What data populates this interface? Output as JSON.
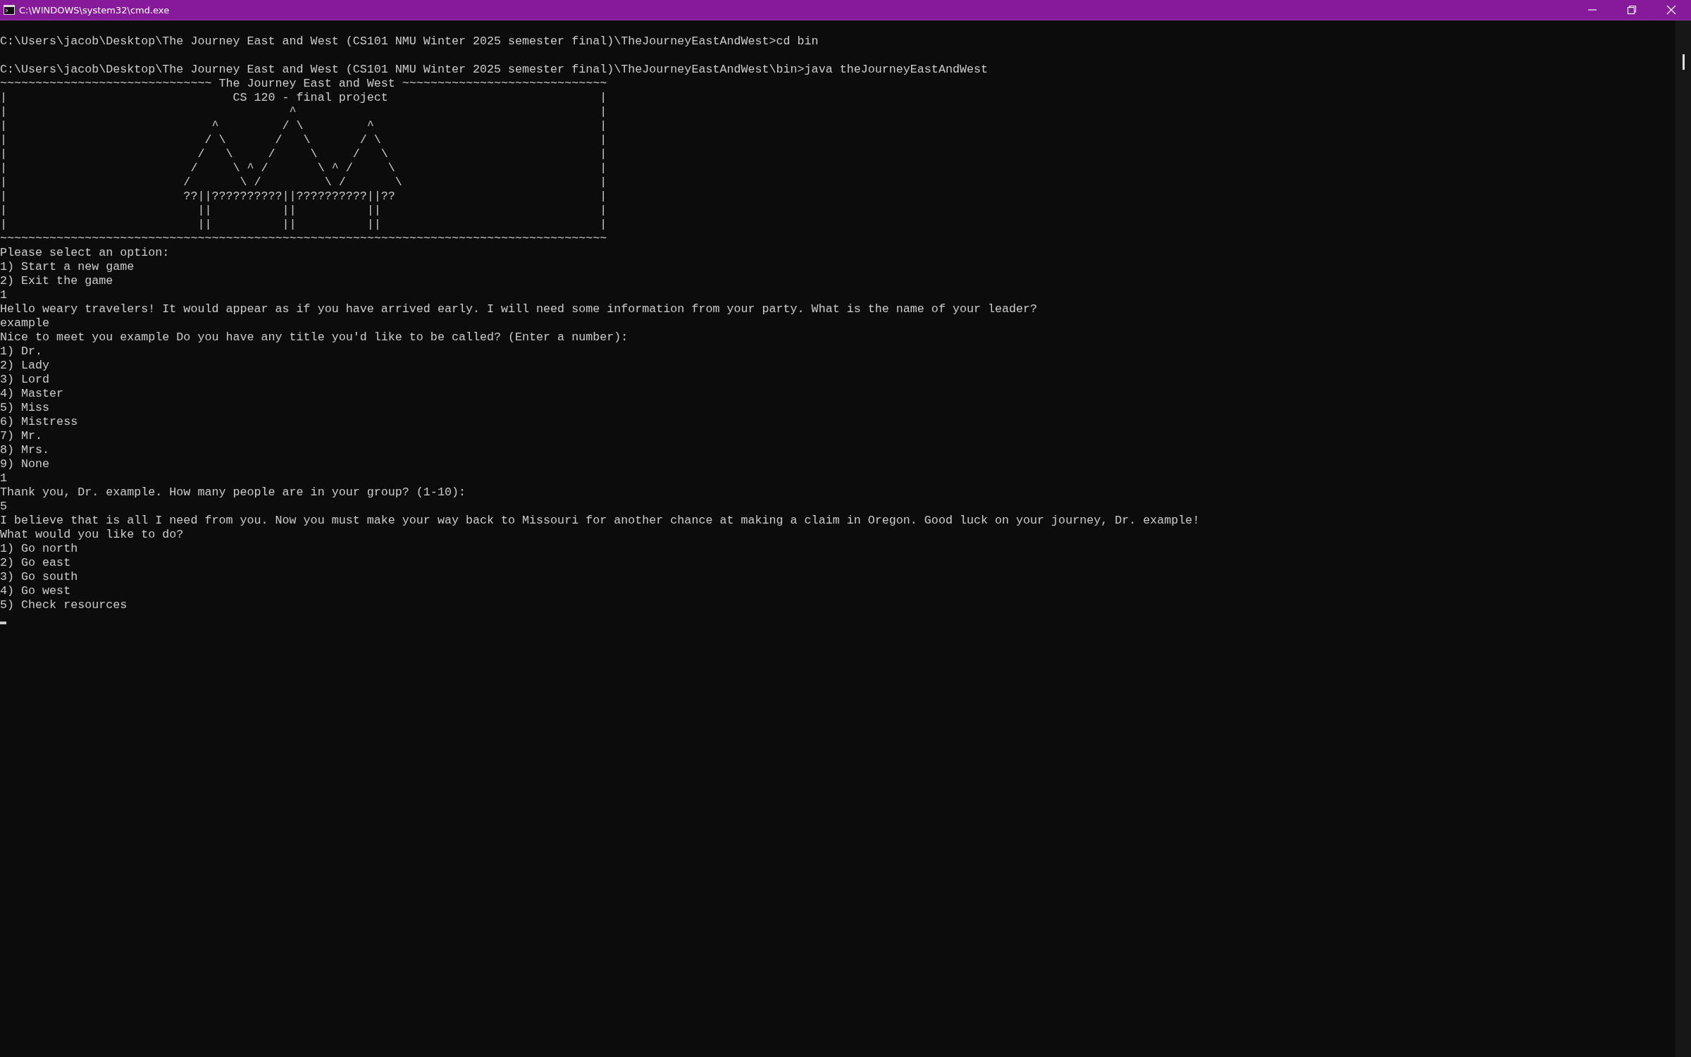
{
  "window": {
    "title": "C:\\WINDOWS\\system32\\cmd.exe"
  },
  "console": {
    "lines": [
      {
        "kind": "blank"
      },
      {
        "kind": "text",
        "text": "C:\\Users\\jacob\\Desktop\\The Journey East and West (CS101 NMU Winter 2025 semester final)\\TheJourneyEastAndWest>cd bin"
      },
      {
        "kind": "blank"
      },
      {
        "kind": "text",
        "text": "C:\\Users\\jacob\\Desktop\\The Journey East and West (CS101 NMU Winter 2025 semester final)\\TheJourneyEastAndWest\\bin>java theJourneyEastAndWest"
      },
      {
        "kind": "text",
        "text": "~~~~~~~~~~~~~~~~~~~~~~~~~~~~~~ The Journey East and West ~~~~~~~~~~~~~~~~~~~~~~~~~~~~~"
      },
      {
        "kind": "text",
        "text": "|                                CS 120 - final project                              |"
      },
      {
        "kind": "text",
        "text": "|                                        ^                                           |"
      },
      {
        "kind": "text",
        "text": "|                             ^         / \\         ^                                |"
      },
      {
        "kind": "text",
        "text": "|                            / \\       /   \\       / \\                               |"
      },
      {
        "kind": "text",
        "text": "|                           /   \\     /     \\     /   \\                              |"
      },
      {
        "kind": "text",
        "text": "|                          /     \\ ^ /       \\ ^ /     \\                             |"
      },
      {
        "kind": "text",
        "text": "|                         /       \\ /         \\ /       \\                            |"
      },
      {
        "kind": "text",
        "text": "|                         ??||??????????||??????????||??                             |"
      },
      {
        "kind": "text",
        "text": "|                           ||          ||          ||                               |"
      },
      {
        "kind": "text",
        "text": "|                           ||          ||          ||                               |"
      },
      {
        "kind": "text",
        "text": "~~~~~~~~~~~~~~~~~~~~~~~~~~~~~~~~~~~~~~~~~~~~~~~~~~~~~~~~~~~~~~~~~~~~~~~~~~~~~~~~~~~~~~"
      },
      {
        "kind": "text",
        "text": "Please select an option:"
      },
      {
        "kind": "text",
        "text": "1) Start a new game"
      },
      {
        "kind": "text",
        "text": "2) Exit the game"
      },
      {
        "kind": "text",
        "text": "1"
      },
      {
        "kind": "text",
        "text": "Hello weary travelers! It would appear as if you have arrived early. I will need some information from your party. What is the name of your leader?"
      },
      {
        "kind": "text",
        "text": "example"
      },
      {
        "kind": "text",
        "text": "Nice to meet you example Do you have any title you'd like to be called? (Enter a number):"
      },
      {
        "kind": "text",
        "text": "1) Dr."
      },
      {
        "kind": "text",
        "text": "2) Lady"
      },
      {
        "kind": "text",
        "text": "3) Lord"
      },
      {
        "kind": "text",
        "text": "4) Master"
      },
      {
        "kind": "text",
        "text": "5) Miss"
      },
      {
        "kind": "text",
        "text": "6) Mistress"
      },
      {
        "kind": "text",
        "text": "7) Mr."
      },
      {
        "kind": "text",
        "text": "8) Mrs."
      },
      {
        "kind": "text",
        "text": "9) None"
      },
      {
        "kind": "text",
        "text": "1"
      },
      {
        "kind": "text",
        "text": "Thank you, Dr. example. How many people are in your group? (1-10):"
      },
      {
        "kind": "text",
        "text": "5"
      },
      {
        "kind": "text",
        "text": "I believe that is all I need from you. Now you must make your way back to Missouri for another chance at making a claim in Oregon. Good luck on your journey, Dr. example!"
      },
      {
        "kind": "text",
        "text": "What would you like to do?"
      },
      {
        "kind": "text",
        "text": "1) Go north"
      },
      {
        "kind": "text",
        "text": "2) Go east"
      },
      {
        "kind": "text",
        "text": "3) Go south"
      },
      {
        "kind": "text",
        "text": "4) Go west"
      },
      {
        "kind": "text",
        "text": "5) Check resources"
      },
      {
        "kind": "cursor"
      }
    ]
  }
}
